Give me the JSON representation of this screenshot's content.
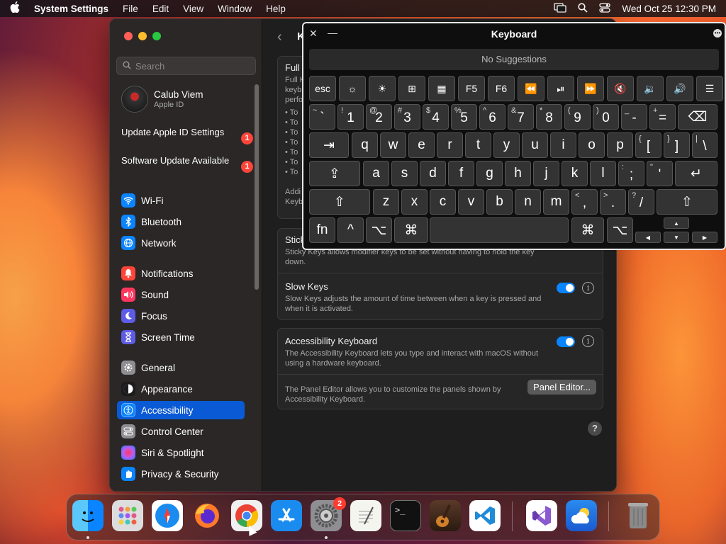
{
  "menubar": {
    "app_name": "System Settings",
    "menus": [
      "File",
      "Edit",
      "View",
      "Window",
      "Help"
    ],
    "datetime": "Wed Oct 25  12:30 PM"
  },
  "sidebar": {
    "search_placeholder": "Search",
    "profile": {
      "name": "Calub Viem",
      "sub": "Apple ID"
    },
    "updates": [
      {
        "label": "Update Apple ID Settings",
        "badge": "1"
      },
      {
        "label": "Software Update Available",
        "badge": "1"
      }
    ],
    "items": [
      {
        "label": "Wi-Fi",
        "icon": "wifi-icon",
        "color": "#0a84ff"
      },
      {
        "label": "Bluetooth",
        "icon": "bluetooth-icon",
        "color": "#0a84ff"
      },
      {
        "label": "Network",
        "icon": "globe-icon",
        "color": "#0a84ff"
      },
      {
        "label": "Notifications",
        "icon": "bell-icon",
        "color": "#ff453a"
      },
      {
        "label": "Sound",
        "icon": "speaker-icon",
        "color": "#ff375f"
      },
      {
        "label": "Focus",
        "icon": "moon-icon",
        "color": "#5e5ce6"
      },
      {
        "label": "Screen Time",
        "icon": "hourglass-icon",
        "color": "#5e5ce6"
      },
      {
        "label": "General",
        "icon": "gear-icon",
        "color": "#8e8e93"
      },
      {
        "label": "Appearance",
        "icon": "appearance-icon",
        "color": "#1c1c1e"
      },
      {
        "label": "Accessibility",
        "icon": "accessibility-icon",
        "color": "#0a84ff"
      },
      {
        "label": "Control Center",
        "icon": "control-center-icon",
        "color": "#8e8e93"
      },
      {
        "label": "Siri & Spotlight",
        "icon": "siri-icon",
        "color": "#bf5af2"
      },
      {
        "label": "Privacy & Security",
        "icon": "hand-icon",
        "color": "#0a84ff"
      }
    ],
    "active": "Accessibility"
  },
  "main": {
    "title": "K",
    "full_card": {
      "title": "Full",
      "desc_lines": [
        "Full K",
        "keyb",
        "perfo"
      ],
      "bullets": [
        "• To",
        "• To",
        "• To",
        "• To",
        "• To",
        "• To",
        "• To"
      ],
      "footer_lines": [
        "Addi",
        "Keyb"
      ]
    },
    "sticky": {
      "title": "Stick",
      "desc": "Sticky Keys allows modifier keys to be set without having to hold the key down."
    },
    "slow": {
      "title": "Slow Keys",
      "desc": "Slow Keys adjusts the amount of time between when a key is pressed and when it is activated."
    },
    "acc_keyboard": {
      "title": "Accessibility Keyboard",
      "desc": "The Accessibility Keyboard lets you type and interact with macOS without using a hardware keyboard."
    },
    "panel_editor": {
      "desc": "The Panel Editor allows you to customize the panels shown by Accessibility Keyboard.",
      "button": "Panel Editor..."
    },
    "help": "?"
  },
  "keyboard": {
    "title": "Keyboard",
    "suggestions": "No Suggestions",
    "row_fn": [
      "esc",
      "☼",
      "☀",
      "⊞",
      "▦",
      "F5",
      "F6",
      "⏪",
      "⏯",
      "⏩",
      "🔇",
      "🔉",
      "🔊",
      "☰"
    ],
    "row_num": [
      {
        "s": "~",
        "m": "`"
      },
      {
        "s": "!",
        "m": "1"
      },
      {
        "s": "@",
        "m": "2"
      },
      {
        "s": "#",
        "m": "3"
      },
      {
        "s": "$",
        "m": "4"
      },
      {
        "s": "%",
        "m": "5"
      },
      {
        "s": "^",
        "m": "6"
      },
      {
        "s": "&",
        "m": "7"
      },
      {
        "s": "*",
        "m": "8"
      },
      {
        "s": "(",
        "m": "9"
      },
      {
        "s": ")",
        "m": "0"
      },
      {
        "s": "_",
        "m": "-"
      },
      {
        "s": "+",
        "m": "="
      }
    ],
    "delete": "⌫",
    "tab": "⇥",
    "row_q": [
      "q",
      "w",
      "e",
      "r",
      "t",
      "y",
      "u",
      "i",
      "o",
      "p"
    ],
    "row_q_sym": [
      {
        "s": "{",
        "m": "["
      },
      {
        "s": "}",
        "m": "]"
      },
      {
        "s": "|",
        "m": "\\"
      }
    ],
    "caps": "⇪",
    "row_a": [
      "a",
      "s",
      "d",
      "f",
      "g",
      "h",
      "j",
      "k",
      "l"
    ],
    "row_a_sym": [
      {
        "s": ":",
        "m": ";"
      },
      {
        "s": "\"",
        "m": "'"
      }
    ],
    "return": "↵",
    "shift": "⇧",
    "row_z": [
      "z",
      "x",
      "c",
      "v",
      "b",
      "n",
      "m"
    ],
    "row_z_sym": [
      {
        "s": "<",
        "m": ","
      },
      {
        "s": ">",
        "m": "."
      },
      {
        "s": "?",
        "m": "/"
      }
    ],
    "row_bottom": [
      "fn",
      "^",
      "⌥",
      "⌘",
      "",
      "⌘",
      "⌥"
    ],
    "arrows": [
      "▲",
      "◀",
      "▼",
      "▶"
    ]
  },
  "dock": {
    "items": [
      "Finder",
      "Launchpad",
      "Safari",
      "Firefox",
      "Chrome",
      "App Store",
      "System Settings",
      "TextEdit",
      "Terminal",
      "GarageBand",
      "VS Code",
      "Visual Studio",
      "Weather",
      "Trash"
    ],
    "settings_badge": "2"
  }
}
